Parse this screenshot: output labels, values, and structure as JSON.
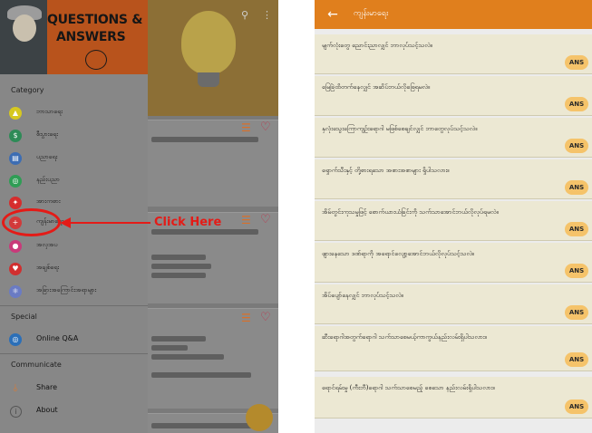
{
  "left_screen": {
    "header": {
      "logo_line1": "QUESTIONS &",
      "logo_line2": "ANSWERS"
    },
    "category_title": "Category",
    "categories": [
      {
        "label": "ဘာသာရေး",
        "icon": "pagoda-icon",
        "color": "#d6c820"
      },
      {
        "label": "စီးပွားရေး",
        "icon": "money-bag-icon",
        "color": "#2e8b57"
      },
      {
        "label": "ပညာရေး",
        "icon": "books-icon",
        "color": "#3d6db3"
      },
      {
        "label": "နည်းပညာ",
        "icon": "globe-icon",
        "color": "#2f9d55"
      },
      {
        "label": "အားကစား",
        "icon": "runner-icon",
        "color": "#d62d2d"
      },
      {
        "label": "ကျန်းမာရေး",
        "icon": "medical-cross-icon",
        "color": "#d23a3a"
      },
      {
        "label": "အလှအပ",
        "icon": "lipstick-icon",
        "color": "#c93a7a"
      },
      {
        "label": "အချစ်ရေး",
        "icon": "heart-icon",
        "color": "#d12f2f"
      },
      {
        "label": "အခြားအကြောင်းအရာများ",
        "icon": "atom-icon",
        "color": "#6a7bc4"
      }
    ],
    "special_title": "Special",
    "special_items": [
      {
        "label": "Online Q&A",
        "icon": "globe-icon",
        "color": "#2b6fb8"
      }
    ],
    "communicate_title": "Communicate",
    "communicate_items": [
      {
        "label": "Share",
        "icon": "share-icon",
        "color": "#e4792a"
      },
      {
        "label": "About",
        "icon": "info-icon",
        "color": "#555555"
      }
    ],
    "annotation": {
      "text": "Click Here",
      "color": "#e41b17"
    }
  },
  "right_screen": {
    "title": "ကျန်းမာရေး",
    "accent": "#e07f1d",
    "answer_label": "ANS",
    "questions": [
      "မျက်လုံးတွေ ညောင်းညာလျှင် ဘာလုပ်သင့်သလဲ။",
      "မြေခြဲထိတက်နေလျှင် အဆိပ်ဘယ်လိုဖြေရမလဲ။",
      "နှလုံးသွေးကြောကျဉ်းရောဂါ မဖြစ်စေချင်လျှင် ဘာတွေလုပ်သင့်သလဲ။",
      "ရှောက်သီးနှင့် တို့စားရသော အစားအစာများ ရှိပါသလား။",
      "အိမ်တွင်းကုသမှုဖြင့် စောက်ယားယံခြင်းကို သက်သာအောင်ဘယ်လိုလုပ်ရမလဲ။",
      "ဖျားနေသော ဒဏ်ရာကို အရောင်လျော့အောင်ဘယ်လိုလုပ်သင့်သလဲ။",
      "အိပ်ပျော်နေလျှင် ဘာလုပ်သင့်သလဲ။",
      "ဆီးရောဂါအတွက်ရောဂါ သက်သာစေမယ့်ကာကွယ်နည်းလမ်းရှိပါသလား။",
      "ရောင်ရမ်းမှု (ကီးဘီ)ရောဂါ သက်သာစေမည့် စေသော နည်းလမ်းရှိပါသလား။"
    ]
  }
}
